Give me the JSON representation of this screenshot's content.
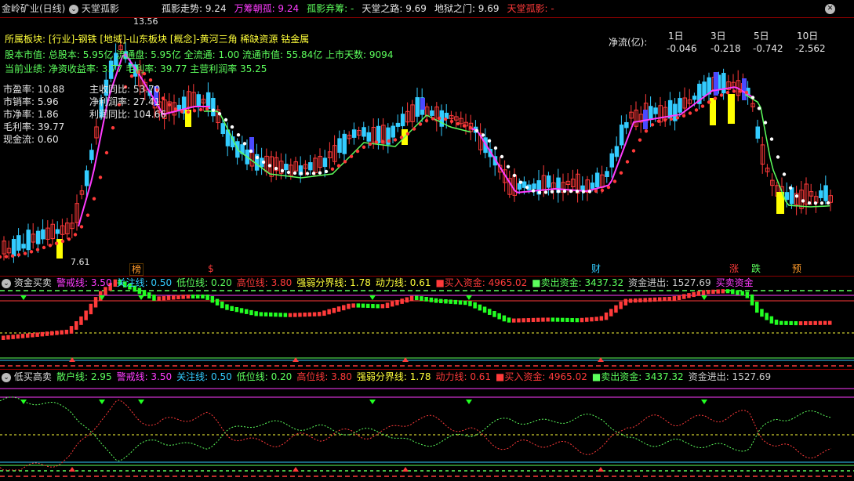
{
  "header": {
    "stock_name": "金岭矿业(日线)",
    "indicator_name": "天堂孤影",
    "items": [
      {
        "label": "孤影走势: 9.24",
        "color": "#e6e6e6"
      },
      {
        "label": "万筹朝孤: 9.24",
        "color": "#ff3cff"
      },
      {
        "label": "孤影弃筹: -",
        "color": "#5dff5d"
      },
      {
        "label": "天堂之路: 9.69",
        "color": "#e6e6e6"
      },
      {
        "label": "地狱之门: 9.69",
        "color": "#e6e6e6"
      },
      {
        "label": "天堂孤影: -",
        "color": "#ff3a3a"
      }
    ]
  },
  "info": {
    "line1": "所属板块: [行业]-钢铁 [地域]-山东板块 [概念]-黄河三角 稀缺资源 钴金属",
    "line2": "股本市值: 总股本: 5.95亿 流通盘: 5.95亿 全流通: 1.00 流通市值: 55.84亿 上市天数: 9094",
    "line3": "当前业绩: 净资收益率: 3.77 毛利率: 39.77 主营利润率 35.25",
    "ratios": [
      "市盈率: 10.88",
      "市销率: 5.96",
      "市净率: 1.86",
      "毛利率: 39.77",
      "现金流: 0.60"
    ],
    "growth": [
      "主收同比: 53.70",
      "净利润率: 27.41",
      "利润同比: 104.66"
    ]
  },
  "netflow": {
    "label": "净流(亿):",
    "headers": [
      "1日",
      "3日",
      "5日",
      "10日"
    ],
    "values": [
      "-0.046",
      "-0.218",
      "-0.742",
      "-2.562"
    ]
  },
  "price_labels": {
    "high": "13.56",
    "low": "7.61"
  },
  "event_tags": [
    {
      "text": "榜",
      "color": "#ff9a2a"
    },
    {
      "text": "$",
      "color": "#ff3a3a"
    },
    {
      "text": "财",
      "color": "#3cf"
    },
    {
      "text": "涨",
      "color": "#ff3a3a"
    },
    {
      "text": "跌",
      "color": "#5dff5d"
    },
    {
      "text": "预",
      "color": "#ff9a2a"
    }
  ],
  "pane2": {
    "name": "资金买卖",
    "items": [
      {
        "label": "警戒线: 3.50",
        "color": "#ff3cff"
      },
      {
        "label": "关注线: 0.50",
        "color": "#3cf"
      },
      {
        "label": "低位线: 0.20",
        "color": "#5dff5d"
      },
      {
        "label": "高位线: 3.80",
        "color": "#ff3a3a"
      },
      {
        "label": "强弱分界线: 1.78",
        "color": "#ffff3a"
      },
      {
        "label": "动力线: 0.61",
        "color": "#ffff3a"
      },
      {
        "label": "■买入资金: 4965.02",
        "color": "#ff3a3a"
      },
      {
        "label": "■卖出资金: 3437.32",
        "color": "#5dff5d"
      },
      {
        "label": "资金进出: 1527.69",
        "color": "#ccc"
      },
      {
        "label": "买卖资金",
        "color": "#ff3cff"
      }
    ]
  },
  "pane3": {
    "name": "低买高卖",
    "items": [
      {
        "label": "散户线: 2.95",
        "color": "#5dff5d"
      },
      {
        "label": "警戒线: 3.50",
        "color": "#ff3cff"
      },
      {
        "label": "关注线: 0.50",
        "color": "#3cf"
      },
      {
        "label": "低位线: 0.20",
        "color": "#5dff5d"
      },
      {
        "label": "高位线: 3.80",
        "color": "#ff3a3a"
      },
      {
        "label": "强弱分界线: 1.78",
        "color": "#ffff3a"
      },
      {
        "label": "动力线: 0.61",
        "color": "#ff3a3a"
      },
      {
        "label": "■买入资金: 4965.02",
        "color": "#ff3a3a"
      },
      {
        "label": "■卖出资金: 3437.32",
        "color": "#5dff5d"
      },
      {
        "label": "资金进出: 1527.69",
        "color": "#ccc"
      }
    ]
  },
  "colors": {
    "up": "#ff3a3a",
    "down": "#3cf",
    "bg": "#000"
  }
}
